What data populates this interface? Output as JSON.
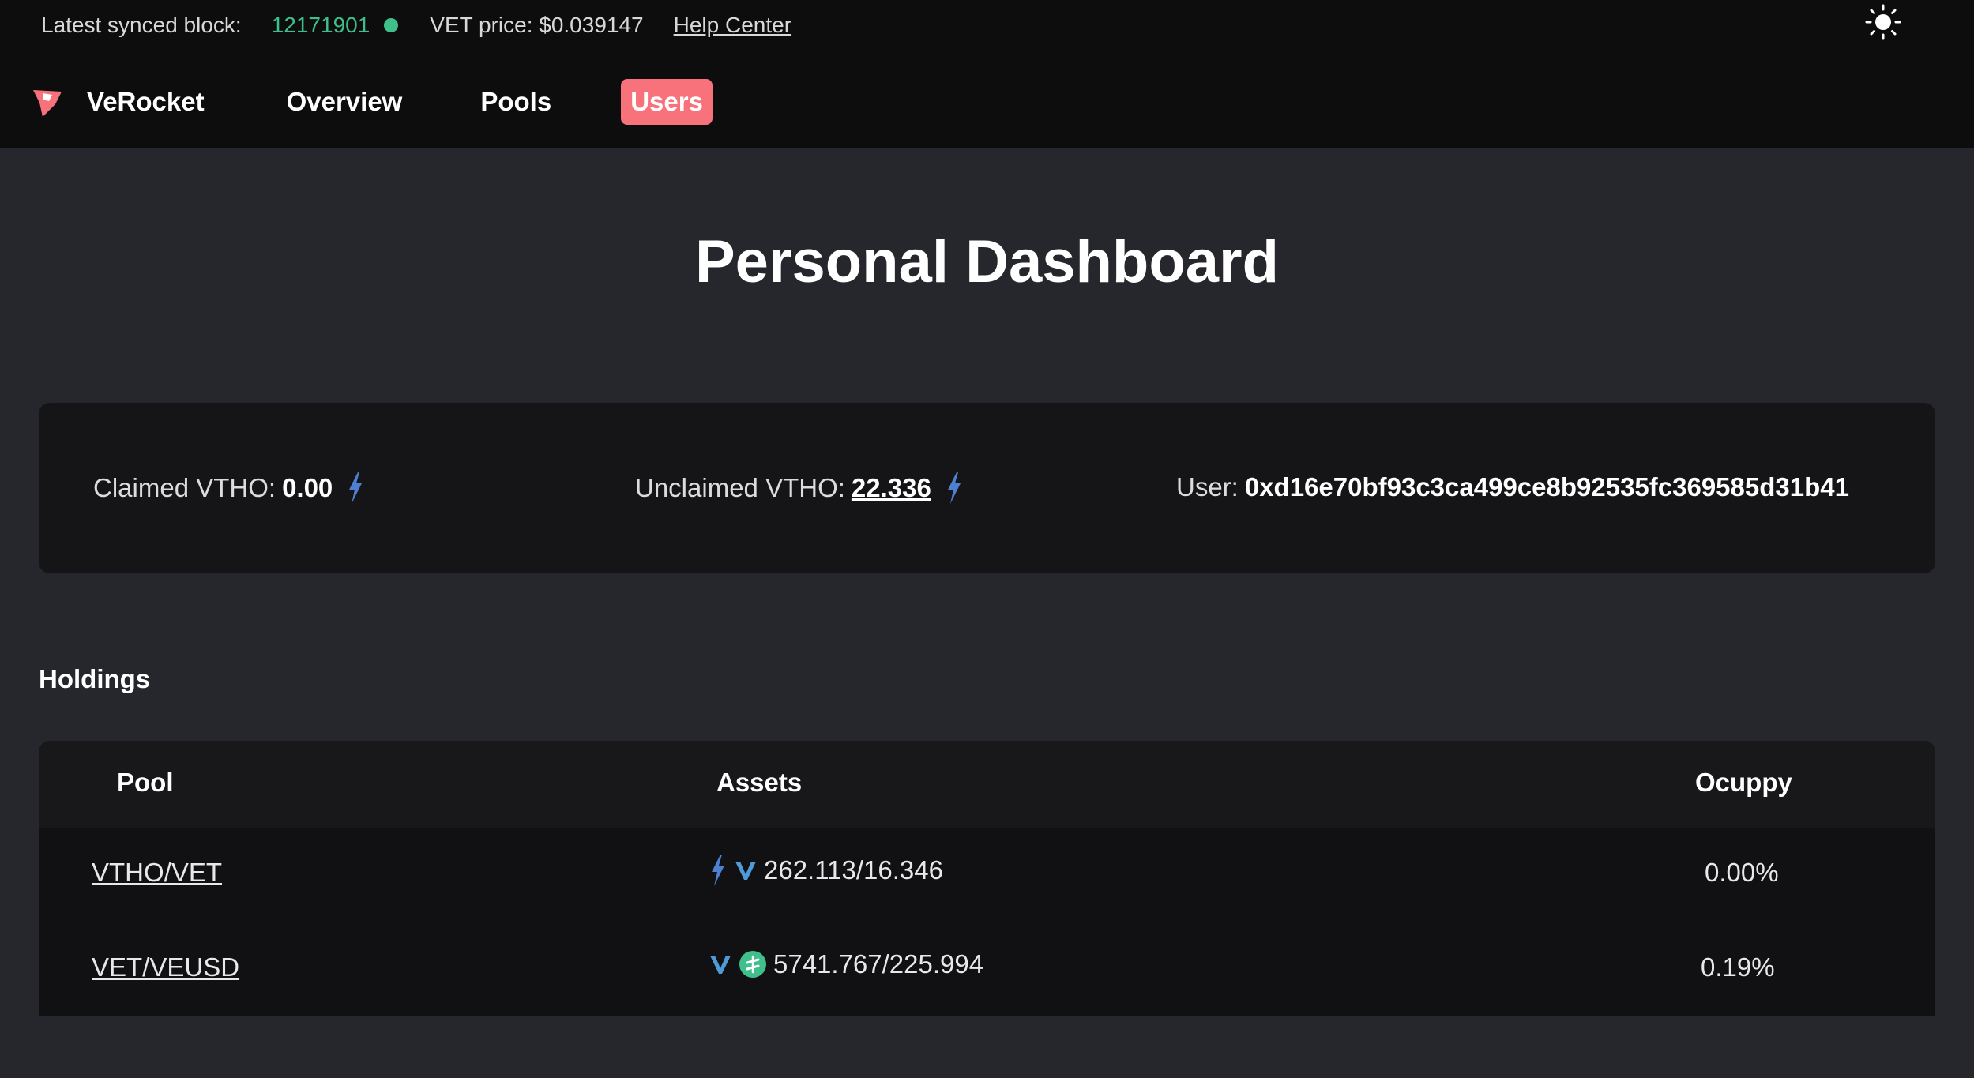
{
  "infobar": {
    "block_label": "Latest synced block:",
    "block_number": "12171901",
    "vet_price": "VET price: $0.039147",
    "help_link": "Help Center"
  },
  "nav": {
    "brand": "VeRocket",
    "items": [
      {
        "label": "Overview"
      },
      {
        "label": "Pools"
      },
      {
        "label": "Users"
      }
    ]
  },
  "page": {
    "title": "Personal Dashboard"
  },
  "stats": {
    "claimed_label": "Claimed VTHO:",
    "claimed_value": "0.00",
    "unclaimed_label": "Unclaimed VTHO:",
    "unclaimed_value": "22.336",
    "user_label": "User:",
    "user_address": "0xd16e70bf93c3ca499ce8b92535fc369585d31b41"
  },
  "holdings": {
    "title": "Holdings",
    "columns": [
      "Pool",
      "Assets",
      "Ocuppy"
    ],
    "rows": [
      {
        "pool": "VTHO/VET",
        "assets": "262.113/16.346",
        "occupy": "0.00%",
        "icons": [
          "vtho-icon",
          "vet-icon"
        ]
      },
      {
        "pool": "VET/VEUSD",
        "assets": "5741.767/225.994",
        "occupy": "0.19%",
        "icons": [
          "vet-icon",
          "veusd-icon"
        ]
      }
    ]
  },
  "colors": {
    "accent": "#f8727c",
    "status_green": "#3fbf8c",
    "vtho_blue": "#4f7fd0"
  }
}
